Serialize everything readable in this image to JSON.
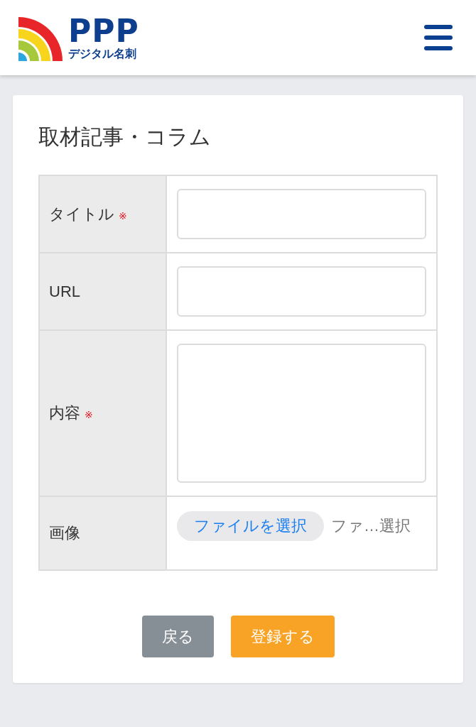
{
  "header": {
    "logo": {
      "name": "PPP",
      "subtitle": "デジタル名刺"
    }
  },
  "form": {
    "title": "取材記事・コラム",
    "fields": [
      {
        "kind": "text",
        "label": "タイトル",
        "mark": "※"
      },
      {
        "kind": "text",
        "label": "URL"
      },
      {
        "kind": "textarea",
        "label": "内容",
        "mark": "※"
      },
      {
        "kind": "file",
        "label": "画像",
        "button": "ファイルを選択",
        "value": "ファ…選択"
      }
    ],
    "buttons": [
      {
        "kind": "secondary",
        "label": "戻る"
      },
      {
        "kind": "primary",
        "label": "登録する"
      }
    ]
  }
}
